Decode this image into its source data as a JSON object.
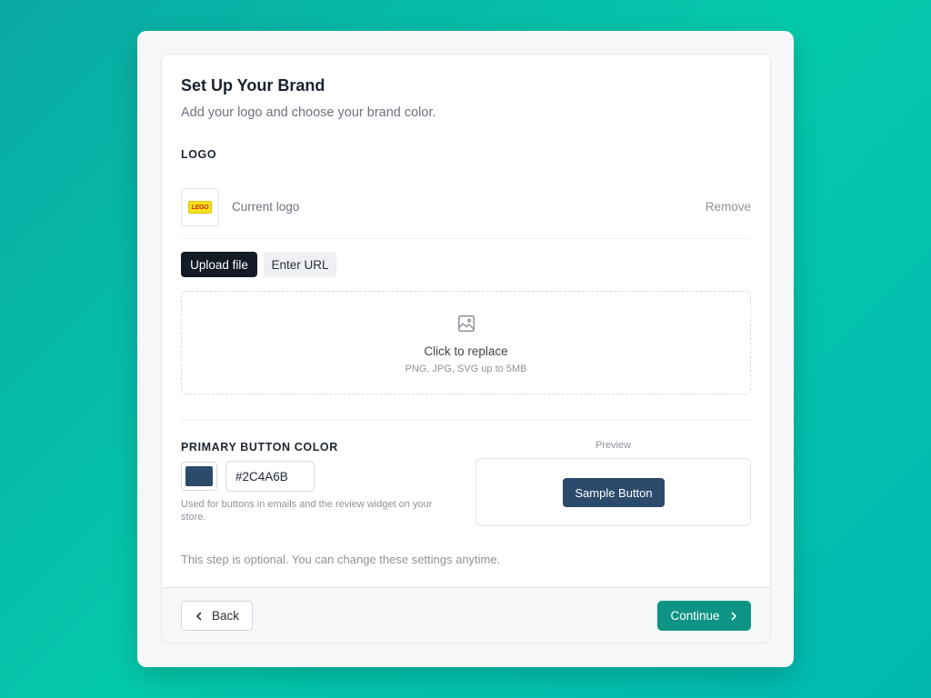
{
  "colors": {
    "brand_color": "#2C4A6B",
    "continue_bg": "#0E9484",
    "dark_tab": "#141A26"
  },
  "header": {
    "title": "Set Up Your Brand",
    "subtitle": "Add your logo and choose your brand color."
  },
  "logo_section": {
    "label": "LOGO",
    "logo_text": "LEGO",
    "current_logo_label": "Current logo",
    "remove_label": "Remove",
    "tabs": [
      {
        "label": "Upload file",
        "active": true
      },
      {
        "label": "Enter URL",
        "active": false
      }
    ],
    "dropzone": {
      "icon": "image-icon",
      "title": "Click to replace",
      "hint": "PNG, JPG, SVG up to 5MB"
    }
  },
  "color_section": {
    "label": "PRIMARY BUTTON COLOR",
    "hex_value": "#2C4A6B",
    "hint": "Used for buttons in emails and the review widget on your store.",
    "preview_label": "Preview",
    "sample_button_label": "Sample Button"
  },
  "optional_note": "This step is optional. You can change these settings anytime.",
  "footer": {
    "back_label": "Back",
    "back_icon": "chevron-left-icon",
    "continue_label": "Continue",
    "continue_icon": "chevron-right-icon"
  }
}
